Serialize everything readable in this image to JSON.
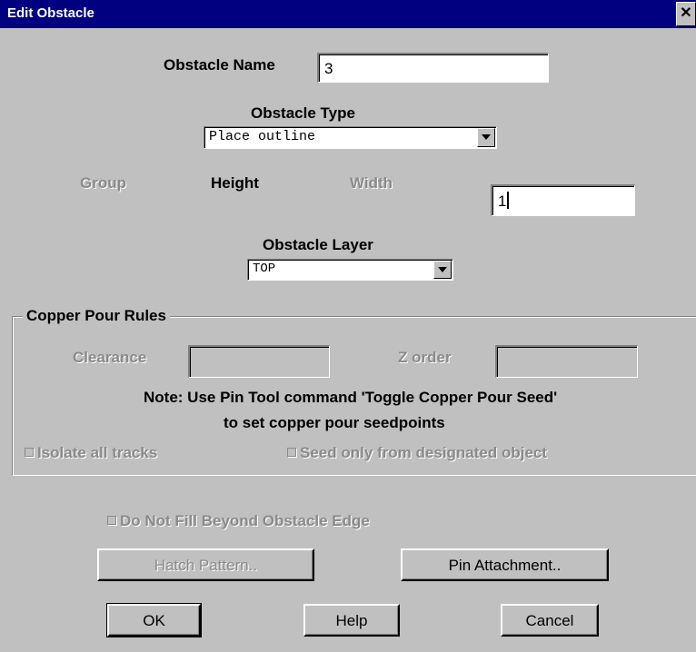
{
  "window": {
    "title": "Edit Obstacle",
    "close_glyph": "✕"
  },
  "obstacle_name": {
    "label": "Obstacle Name",
    "value": "3"
  },
  "obstacle_type": {
    "label": "Obstacle Type",
    "selected": "Place outline"
  },
  "group": {
    "label": "Group"
  },
  "height": {
    "label": "Height"
  },
  "width": {
    "label": "Width",
    "value": "1"
  },
  "obstacle_layer": {
    "label": "Obstacle Layer",
    "selected": "TOP"
  },
  "copper_pour": {
    "title": "Copper Pour Rules",
    "clearance_label": "Clearance",
    "clearance_value": "",
    "zorder_label": "Z order",
    "zorder_value": "",
    "note_line1": "Note: Use Pin Tool command 'Toggle Copper Pour Seed'",
    "note_line2": "to set copper pour seedpoints",
    "isolate_label": "Isolate all tracks",
    "seed_label": "Seed only from designated object"
  },
  "do_not_fill_label": "Do Not Fill Beyond Obstacle Edge",
  "buttons": {
    "hatch": "Hatch Pattern..",
    "pin_attachment": "Pin Attachment..",
    "ok": "OK",
    "help": "Help",
    "cancel": "Cancel"
  },
  "colors": {
    "titlebar": "#000080",
    "dialog_bg": "#c0c0c0",
    "disabled_text": "#8a8a8a"
  }
}
